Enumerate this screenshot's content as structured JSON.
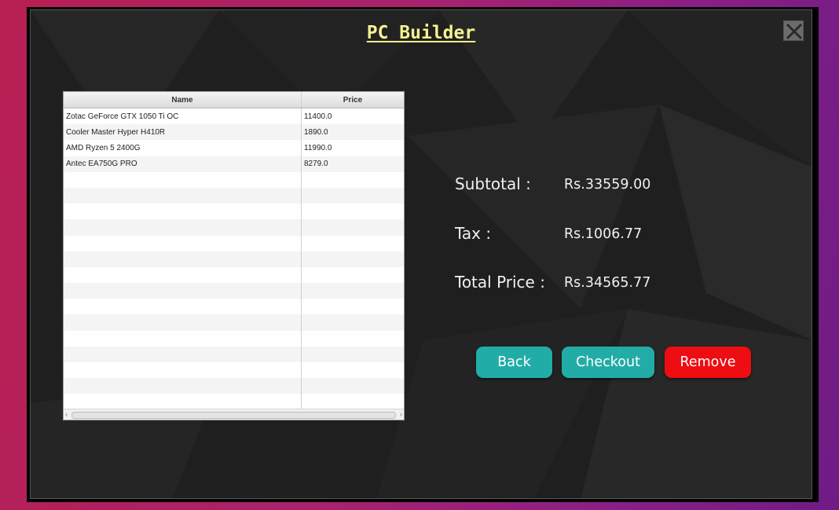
{
  "window": {
    "title": "PC Builder"
  },
  "table": {
    "columns": [
      "Name",
      "Price"
    ],
    "rows": [
      {
        "name": "Zotac GeForce GTX 1050 Ti OC",
        "price": "11400.0"
      },
      {
        "name": "Cooler Master Hyper H410R",
        "price": "1890.0"
      },
      {
        "name": "AMD Ryzen 5 2400G",
        "price": "11990.0"
      },
      {
        "name": "Antec EA750G PRO",
        "price": "8279.0"
      }
    ]
  },
  "summary": {
    "subtotal_label": "Subtotal :",
    "subtotal_value": "Rs.33559.00",
    "tax_label": "Tax :",
    "tax_value": "Rs.1006.77",
    "total_label": "Total Price :",
    "total_value": "Rs.34565.77"
  },
  "buttons": {
    "back": "Back",
    "checkout": "Checkout",
    "remove": "Remove"
  },
  "colors": {
    "title": "#f4f28e",
    "teal_button": "#22aca7",
    "remove_button": "#ee0d12",
    "panel_background": "#1f1f1f"
  },
  "icons": {
    "close": "close-icon"
  }
}
